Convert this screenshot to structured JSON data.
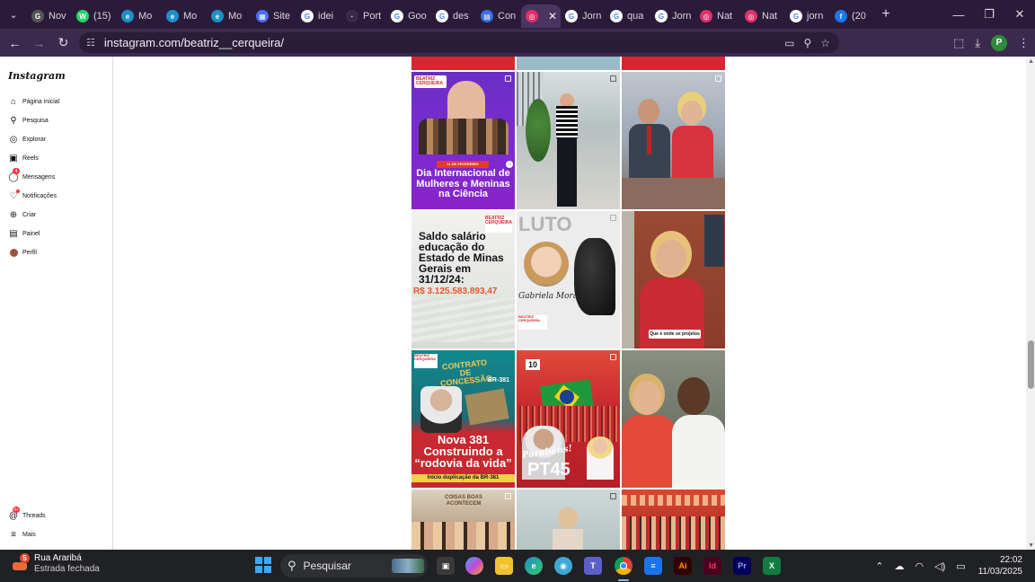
{
  "browser": {
    "tabs": [
      {
        "label": "Nov",
        "color": "#555555",
        "glyph": "G"
      },
      {
        "label": "(15)",
        "color": "#25d366",
        "glyph": "W"
      },
      {
        "label": "Mo",
        "color": "#1e8fc9",
        "glyph": "e"
      },
      {
        "label": "Mo",
        "color": "#1e8fc9",
        "glyph": "e"
      },
      {
        "label": "Mo",
        "color": "#1e8fc9",
        "glyph": "e"
      },
      {
        "label": "Site",
        "color": "#4c6ef5",
        "glyph": "▦"
      },
      {
        "label": "idei",
        "color": "#ffffff",
        "glyph": "G"
      },
      {
        "label": "Port",
        "color": "#3b2a4d",
        "glyph": "·"
      },
      {
        "label": "Goo",
        "color": "#ffffff",
        "glyph": "G"
      },
      {
        "label": "des",
        "color": "#ffffff",
        "glyph": "G"
      },
      {
        "label": "Con",
        "color": "#3b6fe0",
        "glyph": "▤"
      },
      {
        "label": "",
        "color": "#e1306c",
        "glyph": "◎",
        "active": true
      },
      {
        "label": "Jorn",
        "color": "#ffffff",
        "glyph": "G"
      },
      {
        "label": "qua",
        "color": "#ffffff",
        "glyph": "G"
      },
      {
        "label": "Jorn",
        "color": "#ffffff",
        "glyph": "G"
      },
      {
        "label": "Nat",
        "color": "#e1306c",
        "glyph": "◎"
      },
      {
        "label": "Nat",
        "color": "#e1306c",
        "glyph": "◎"
      },
      {
        "label": "jorn",
        "color": "#ffffff",
        "glyph": "G"
      },
      {
        "label": "(20",
        "color": "#1877f2",
        "glyph": "f"
      }
    ],
    "url": "instagram.com/beatriz__cerqueira/",
    "profile_initial": "P"
  },
  "sidebar": {
    "logo": "Instagram",
    "items": [
      {
        "label": "Página inicial",
        "icon": "home-icon",
        "glyph": "⌂"
      },
      {
        "label": "Pesquisa",
        "icon": "search-icon",
        "glyph": "⚲"
      },
      {
        "label": "Explorar",
        "icon": "compass-icon",
        "glyph": "◎"
      },
      {
        "label": "Reels",
        "icon": "reels-icon",
        "glyph": "▣"
      },
      {
        "label": "Mensagens",
        "icon": "messenger-icon",
        "glyph": "◯",
        "badge": "4"
      },
      {
        "label": "Notificações",
        "icon": "heart-icon",
        "glyph": "♡",
        "dot": true
      },
      {
        "label": "Criar",
        "icon": "plus-icon",
        "glyph": "⊕"
      },
      {
        "label": "Painel",
        "icon": "dashboard-icon",
        "glyph": "▤"
      },
      {
        "label": "Perfil",
        "icon": "avatar",
        "glyph": ""
      }
    ],
    "bottom": [
      {
        "label": "Threads",
        "icon": "threads-icon",
        "glyph": "@",
        "badge": "9+"
      },
      {
        "label": "Mais",
        "icon": "menu-icon",
        "glyph": "≡"
      }
    ]
  },
  "posts": {
    "p1_banner": "11 DE FEVEREIRO",
    "p1_title": "Dia Internacional de Mulheres e Meninas na Ciência",
    "p1_brand": "BEATRIZ CERQUEIRA",
    "p4_text": "Saldo salário educação do Estado de Minas Gerais em 31/12/24:",
    "p4_amount": "R$ 3.125.583.893,47",
    "p5_title": "LUTO",
    "p5_name": "Gabriela Moraes",
    "p6_caption": "Que é onde os projetos",
    "p7_top": "CONTRATO DE CONCESSÃO",
    "p7_br": "BR-381",
    "p7_title": "Nova 381 Construindo a “rodovia da vida”",
    "p7_sub": "Início duplicação da BR-381",
    "p8_num": "10",
    "p8_title": "Parabéns!",
    "p8_pt": "PT45",
    "p10_text": "COISAS BOAS ACONTECEM"
  },
  "taskbar": {
    "weather_title": "Rua Araribá",
    "weather_sub": "Estrada fechada",
    "weather_badge": "5",
    "search_placeholder": "Pesquisar",
    "time": "22:02",
    "date": "11/03/2025"
  }
}
